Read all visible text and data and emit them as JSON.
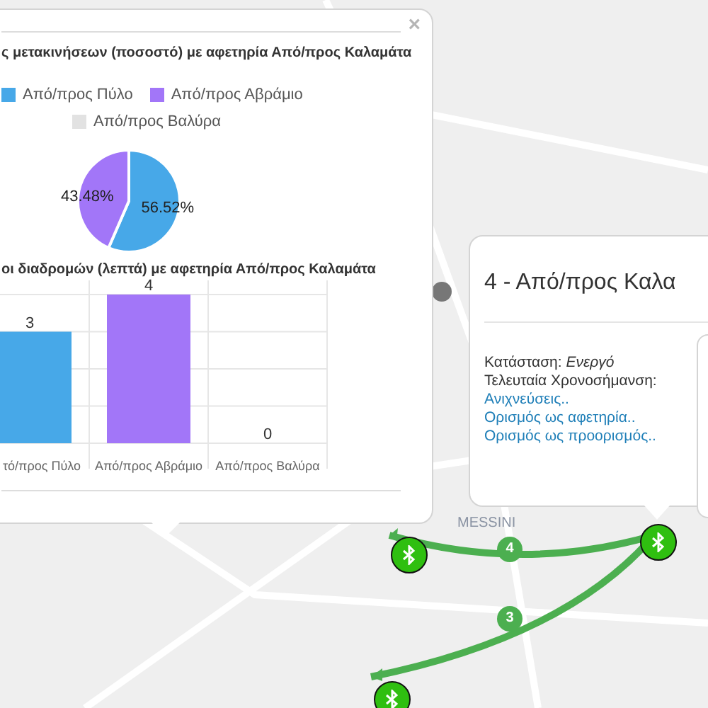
{
  "map": {
    "place_label": "MESSINI",
    "routes": [
      {
        "count": "4"
      },
      {
        "count": "3"
      }
    ]
  },
  "stats_popup": {
    "close": "×",
    "pie_title": "ς μετακινήσεων (ποσοστό)  με αφετηρία Από/προς Καλαμάτα",
    "legend": [
      {
        "color": "#47a8e8"
      },
      {
        "color": "#a276f8"
      },
      {
        "color": "#e2e2e2"
      }
    ],
    "pie_chart": {
      "chart_data": {
        "type": "pie",
        "categories": [
          "Από/προς Πύλο",
          "Από/προς Αβράμιο",
          "Από/προς Βαλύρα"
        ],
        "values": [
          56.52,
          43.48,
          0
        ],
        "value_labels": [
          "56.52%",
          "43.48%",
          null
        ]
      }
    },
    "bar_title": "οι διαδρομών (λεπτά) με αφετηρία Από/προς Καλαμάτα",
    "bar_chart": {
      "chart_data": {
        "type": "bar",
        "categories": [
          "τό/προς Πύλο",
          "Από/προς Αβράμιο",
          "Από/προς Βαλύρα"
        ],
        "values": [
          3,
          4,
          0
        ],
        "data_labels": true
      }
    }
  },
  "station_popup": {
    "title": "4 - Από/προς Καλα",
    "fields": [
      {
        "label": "Κατάσταση:",
        "value": "Ενεργό"
      },
      {
        "label": "Τελευταία Χρονοσήμανση:"
      }
    ],
    "links": [
      "Ανιχνεύσεις..",
      "Ορισμός ως αφετηρία..",
      "Ορισμός ως προορισμός.."
    ]
  }
}
